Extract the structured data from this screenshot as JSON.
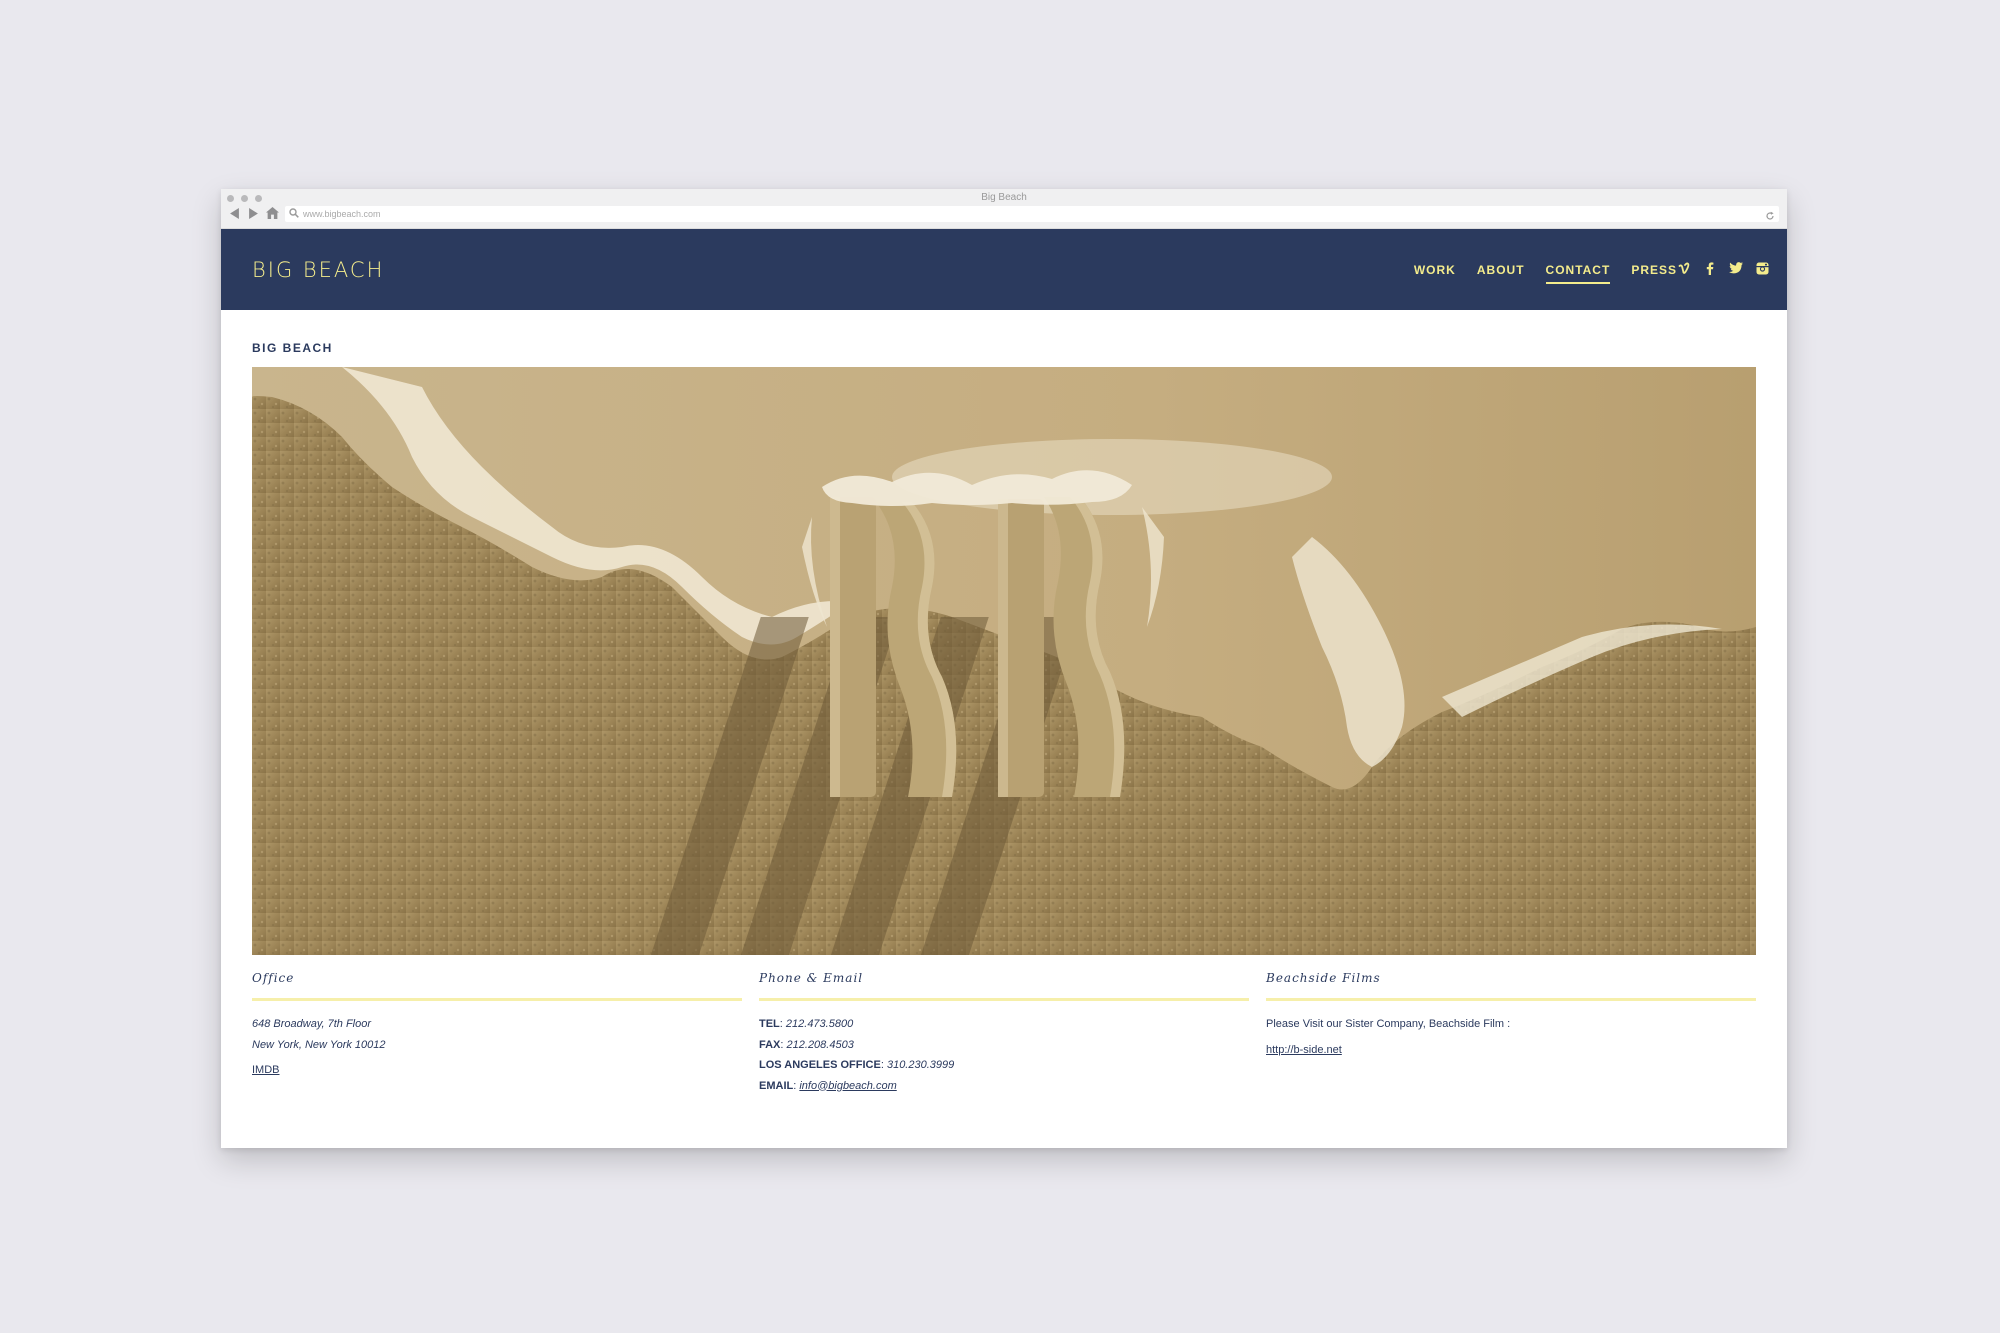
{
  "window": {
    "title": "Big Beach",
    "url": "www.bigbeach.com"
  },
  "header": {
    "logo": "BIG BEACH",
    "menu": [
      {
        "label": "WORK",
        "active": false
      },
      {
        "label": "ABOUT",
        "active": false
      },
      {
        "label": "CONTACT",
        "active": true
      },
      {
        "label": "PRESS",
        "active": false
      }
    ],
    "socials": [
      "vimeo-icon",
      "facebook-icon",
      "twitter-icon",
      "instagram-icon"
    ]
  },
  "page": {
    "title": "BIG BEACH"
  },
  "office": {
    "heading": "Office",
    "address_line1": "648 Broadway, 7th Floor",
    "address_line2": "New York, New York 10012",
    "imdb_link": "IMDB"
  },
  "contact": {
    "heading": "Phone & Email",
    "tel_label": "TEL",
    "tel": "212.473.5800",
    "fax_label": "FAX",
    "fax": "212.208.4503",
    "la_label": "LOS ANGELES OFFICE",
    "la": "310.230.3999",
    "email_label": "EMAIL",
    "email": "info@bigbeach.com"
  },
  "beachside": {
    "heading": "Beachside Films",
    "text": "Please Visit our Sister Company, Beachside Film :",
    "link": "http://b-side.net"
  },
  "colors": {
    "background": "#e9e8ee",
    "header": "#2b3a5e",
    "accent": "#f4ec8c",
    "divider": "#f6efaa"
  }
}
